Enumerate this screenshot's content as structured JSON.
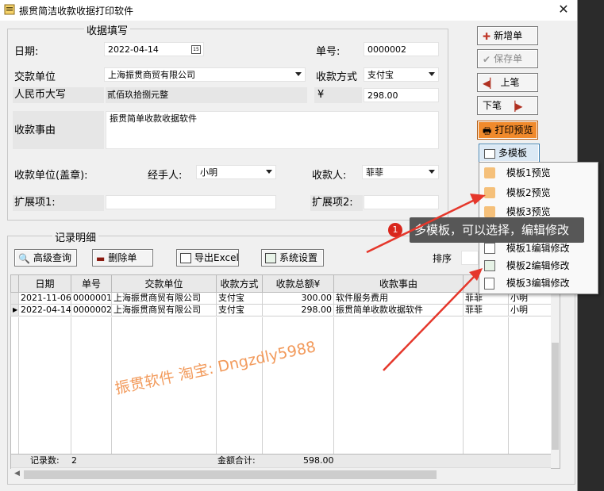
{
  "window": {
    "title": "振贯简洁收款收据打印软件"
  },
  "form": {
    "group_title": "收据填写",
    "date_label": "日期:",
    "date_value": "2022-04-14",
    "no_label": "单号:",
    "no_value": "0000002",
    "payer_label": "交款单位",
    "payer_value": "上海振贯商贸有限公司",
    "method_label": "收款方式",
    "method_value": "支付宝",
    "rmb_label": "人民币大写",
    "rmb_value": "贰佰玖拾捌元整",
    "yen_label": "¥",
    "amount_value": "298.00",
    "reason_label": "收款事由",
    "reason_value": "振贯简单收款收据软件",
    "seal_label": "收款单位(盖章):",
    "handler_label": "经手人:",
    "handler_value": "小明",
    "receiver_label": "收款人:",
    "receiver_value": "菲菲",
    "ext1_label": "扩展项1:",
    "ext2_label": "扩展项2:"
  },
  "right_buttons": {
    "new": "新增单",
    "save": "保存单",
    "prev": "上笔",
    "next": "下笔",
    "print_preview": "打印预览",
    "multi_template": "多模板"
  },
  "records": {
    "group_title": "记录明细",
    "search": "高级查询",
    "delete": "删除单",
    "export": "导出Excel",
    "settings": "系统设置",
    "sort_label": "排序",
    "columns": [
      "日期",
      "单号",
      "交款单位",
      "收款方式",
      "收款总额¥",
      "收款事由",
      "收",
      "经"
    ],
    "rows": [
      [
        "2021-11-06",
        "0000001",
        "上海振贯商贸有限公司",
        "支付宝",
        "300.00",
        "软件服务费用",
        "菲菲",
        "小明"
      ],
      [
        "2022-04-14",
        "0000002",
        "上海振贯商贸有限公司",
        "支付宝",
        "298.00",
        "振贯简单收款收据软件",
        "菲菲",
        "小明"
      ]
    ],
    "footer_count_label": "记录数:",
    "footer_count": "2",
    "footer_total_label": "金额合计:",
    "footer_total": "598.00"
  },
  "menu": {
    "items": [
      "模板1预览",
      "模板2预览",
      "模板3预览",
      "模板1编辑修改",
      "模板2编辑修改",
      "模板3编辑修改"
    ]
  },
  "annotation": {
    "badge": "1",
    "tooltip": "多模板，可以选择，编辑修改"
  },
  "watermark": "振贯软件   淘宝: Dngzdly5988",
  "colors": {
    "accent_orange": "#f08a2c",
    "arrow_red": "#e5372b"
  }
}
